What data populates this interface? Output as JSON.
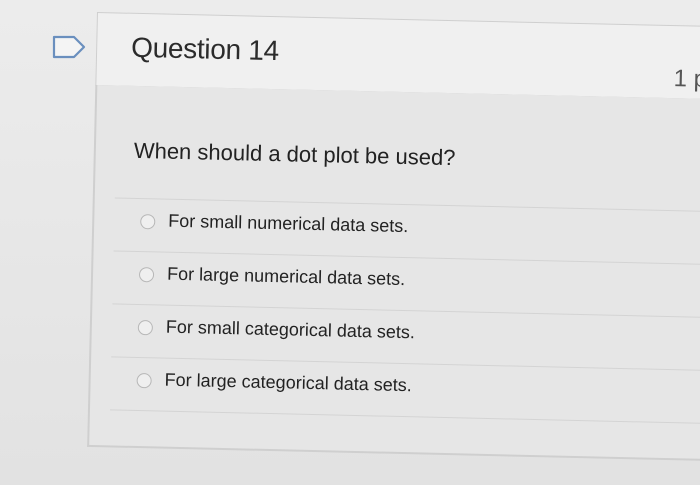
{
  "question": {
    "title": "Question 14",
    "points": "1 p",
    "prompt": "When should a dot plot be used?",
    "choices": [
      "For small numerical data sets.",
      "For large numerical data sets.",
      "For small categorical data sets.",
      "For large categorical data sets."
    ]
  },
  "icons": {
    "flag": "flag-outline-icon",
    "radio": "radio-unselected-icon"
  },
  "colors": {
    "background": "#e9e9e9",
    "header": "#f0f0f0",
    "flag": "#6a8fbe",
    "text": "#222222"
  }
}
